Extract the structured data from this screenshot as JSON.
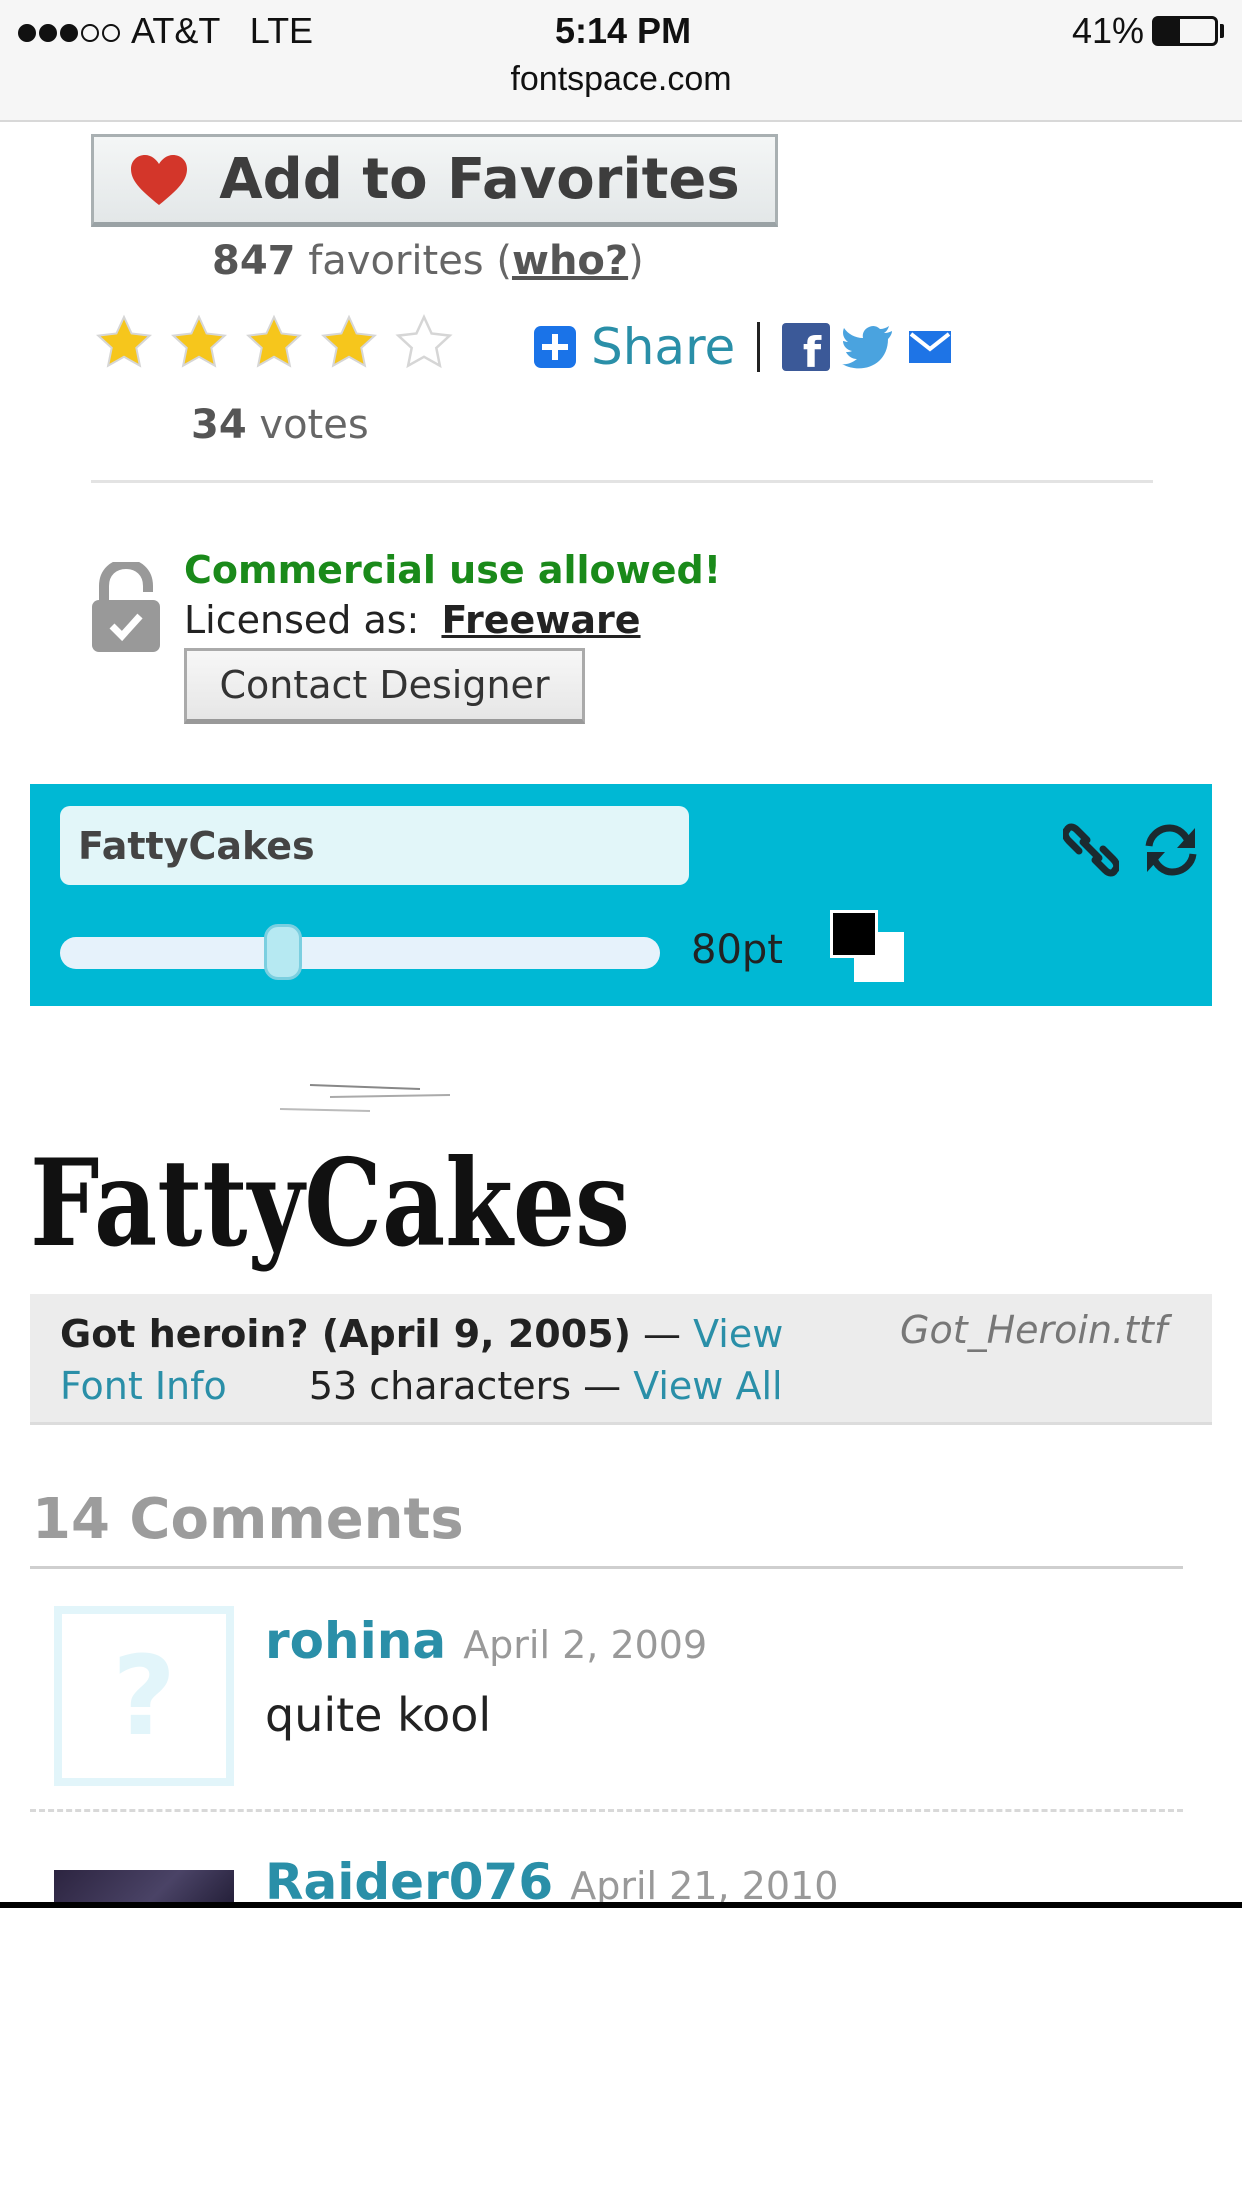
{
  "status_bar": {
    "carrier": "AT&T",
    "network": "LTE",
    "time": "5:14 PM",
    "battery": "41%",
    "battery_level": 0.41,
    "signal_bars": 3,
    "signal_total": 5,
    "url": "fontspace.com"
  },
  "favorites": {
    "button_label": "Add to Favorites",
    "count": "847",
    "text": "favorites",
    "who_link": "who?"
  },
  "rating": {
    "stars_filled": 4,
    "stars_total": 5,
    "votes_count": "34",
    "votes_label": "votes"
  },
  "share": {
    "label": "Share",
    "icons": [
      "facebook-icon",
      "twitter-icon",
      "email-icon"
    ]
  },
  "license": {
    "commercial": "Commercial use allowed!",
    "licensed_as": "Licensed as:",
    "license_name": "Freeware",
    "contact_button": "Contact Designer"
  },
  "preview": {
    "text_value": "FattyCakes",
    "size_label": "80pt",
    "slider_value": 0.38,
    "fg_color": "#000000",
    "bg_color": "#ffffff",
    "accent": "#00b8d4"
  },
  "sample": {
    "text": "FattyCakes"
  },
  "font_info": {
    "name_date": "Got heroin? (April 9, 2005)",
    "dash": "—",
    "view_info_1": "View",
    "view_info_2": "Font Info",
    "characters": "53 characters —",
    "view_all": "View All",
    "file": "Got_Heroin.ttf"
  },
  "comments": {
    "title": "14 Comments",
    "items": [
      {
        "author": "rohina",
        "date": "April 2, 2009",
        "body": "quite kool"
      },
      {
        "author": "Raider076",
        "date": "April 21, 2010",
        "body": ""
      }
    ]
  }
}
